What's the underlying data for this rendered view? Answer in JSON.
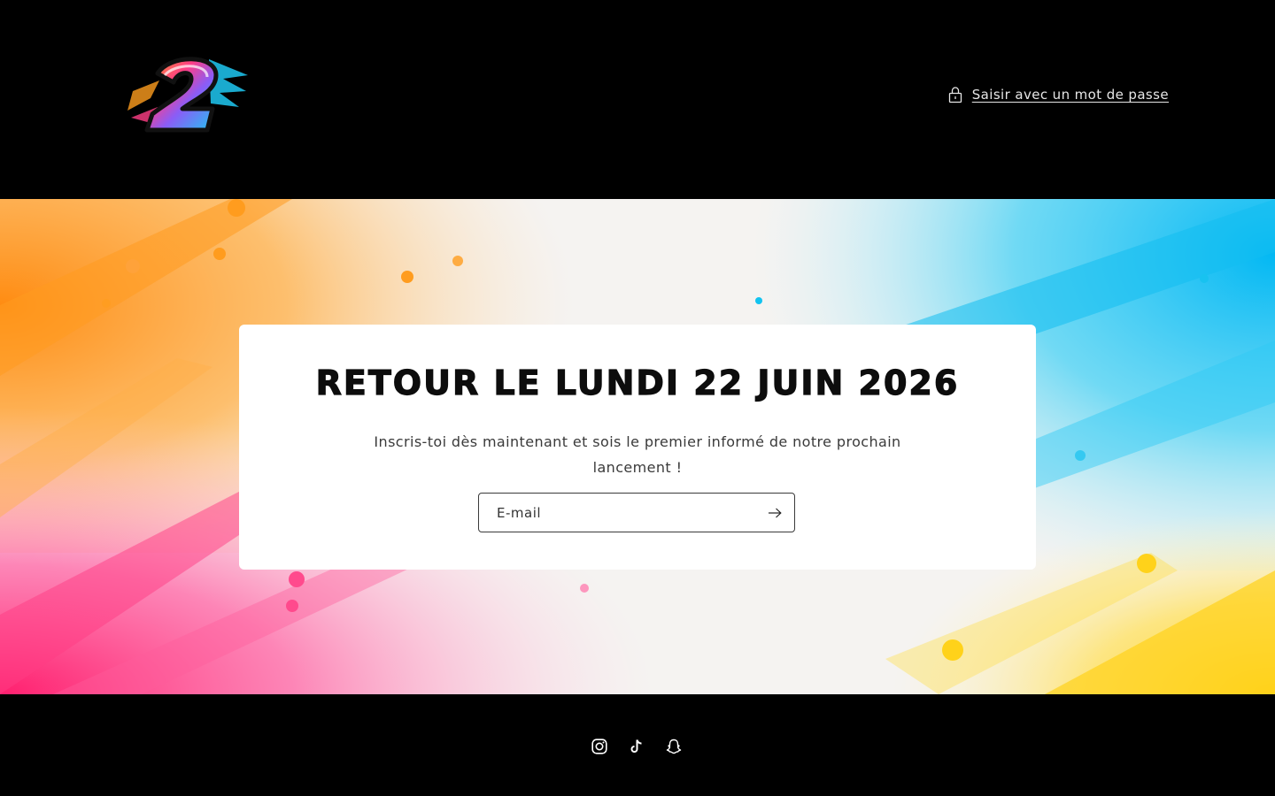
{
  "header": {
    "logo_alt": "2",
    "password_link": "Saisir avec un mot de passe"
  },
  "main": {
    "title": "RETOUR LE LUNDI 22 JUIN 2026",
    "subtitle": "Inscris-toi dès maintenant et sois le premier informé de notre prochain lancement !",
    "email_placeholder": "E-mail",
    "email_value": "",
    "submit_icon": "arrow-right-icon"
  },
  "footer": {
    "socials": [
      {
        "name": "Instagram",
        "icon": "instagram-icon"
      },
      {
        "name": "TikTok",
        "icon": "tiktok-icon"
      },
      {
        "name": "Snapchat",
        "icon": "snapchat-icon"
      }
    ]
  },
  "colors": {
    "background": "#000000",
    "card": "#ffffff",
    "text": "#0d0d0d",
    "orange": "#ff9a1f",
    "pink": "#ff2f7a",
    "cyan": "#12c3f0",
    "yellow": "#ffd51c"
  }
}
